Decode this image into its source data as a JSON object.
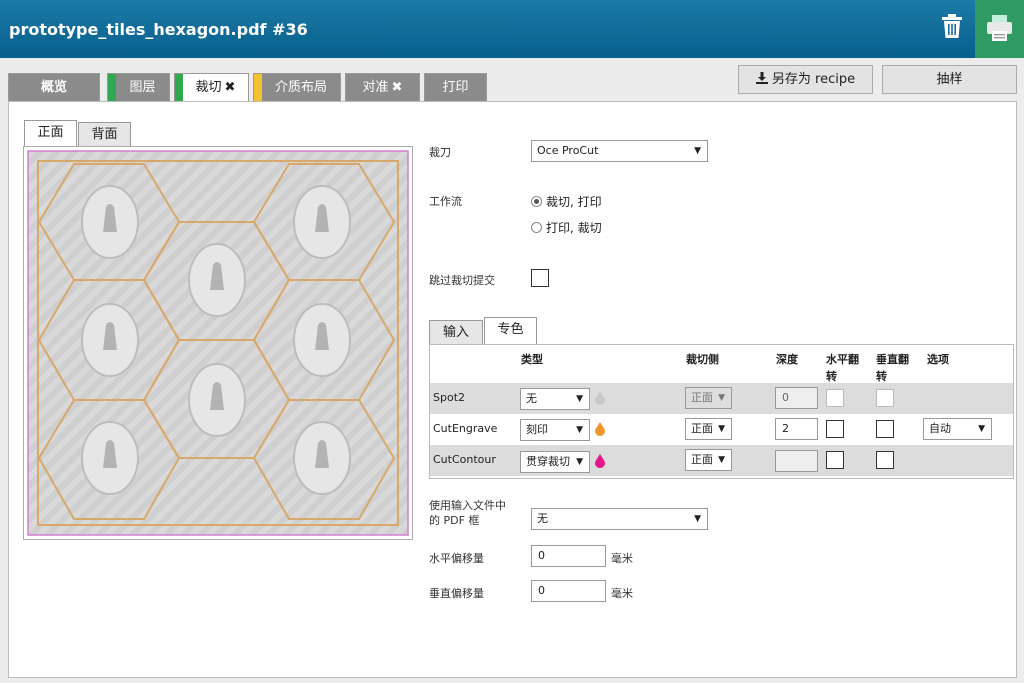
{
  "window": {
    "title": "prototype_tiles_hexagon.pdf #36",
    "trash_icon": "trash-icon",
    "printer_icon": "printer-icon"
  },
  "tabs": [
    {
      "label": "概览",
      "active": false
    },
    {
      "label": "图层",
      "active": false,
      "stripe": "#2fa84f"
    },
    {
      "label": "裁切",
      "active": true,
      "stripe": "#2fa84f",
      "close": "✖"
    },
    {
      "label": "介质布局",
      "active": false,
      "stripe": "#f2c230"
    },
    {
      "label": "对准",
      "active": false,
      "close": "✖"
    },
    {
      "label": "打印",
      "active": false
    }
  ],
  "toolbar": {
    "save_recipe": "另存为 recipe",
    "download_icon": "download-icon",
    "sample": "抽样"
  },
  "sides": {
    "front": "正面",
    "back": "背面"
  },
  "form": {
    "cutter_label": "裁刀",
    "cutter_value": "Oce ProCut",
    "workflow_label": "工作流",
    "workflow_options": [
      "裁切, 打印",
      "打印, 裁切"
    ],
    "workflow_selected": 0,
    "skip_label": "跳过裁切提交",
    "pdf_box_label": "使用输入文件中的 PDF 框",
    "pdf_box_value": "无",
    "h_offset_label": "水平偏移量",
    "h_offset_value": "0",
    "v_offset_label": "垂直偏移量",
    "v_offset_value": "0",
    "unit": "毫米"
  },
  "spot": {
    "tabs": [
      "输入",
      "专色"
    ],
    "headers": {
      "type": "类型",
      "side": "裁切侧",
      "depth": "深度",
      "hflip": "水平翻转",
      "vflip": "垂直翻转",
      "options": "选项"
    },
    "rows": [
      {
        "name": "Spot2",
        "type": "无",
        "drop_color": "#c8c8c8",
        "side": "正面",
        "side_disabled": true,
        "depth": "0",
        "depth_disabled": true,
        "options": ""
      },
      {
        "name": "CutEngrave",
        "type": "刻印",
        "drop_color": "#f0962d",
        "side": "正面",
        "side_disabled": false,
        "depth": "2",
        "depth_disabled": false,
        "options": "自动"
      },
      {
        "name": "CutContour",
        "type": "贯穿裁切",
        "drop_color": "#e4168a",
        "side": "正面",
        "side_disabled": false,
        "depth": "",
        "depth_disabled": true,
        "options": ""
      }
    ]
  }
}
